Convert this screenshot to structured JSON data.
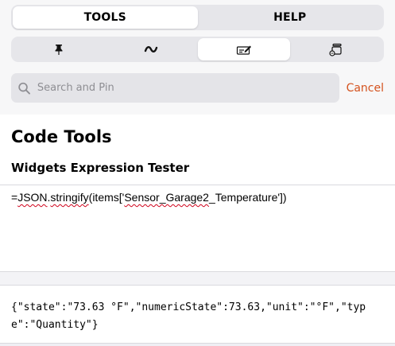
{
  "tabs": [
    {
      "label": "TOOLS",
      "active": true
    },
    {
      "label": "HELP",
      "active": false
    }
  ],
  "tool_icons": [
    {
      "icon": "pin-icon",
      "active": false
    },
    {
      "icon": "wave-icon",
      "active": false
    },
    {
      "icon": "code-edit-icon",
      "active": true
    },
    {
      "icon": "developer-sidebar-icon",
      "active": false
    }
  ],
  "search": {
    "placeholder": "Search and Pin",
    "cancel_label": "Cancel"
  },
  "main": {
    "title": "Code Tools",
    "section_title": "Widgets Expression Tester"
  },
  "editor": {
    "expr_prefix": "=",
    "expr_json": "JSON",
    "expr_mid1": ".",
    "expr_stringify": "stringify",
    "expr_mid2": "(items['",
    "expr_sensor": "Sensor_Garage2",
    "expr_suffix": "_Temperature'])"
  },
  "result": {
    "text": "{\"state\":\"73.63 °F\",\"numericState\":73.63,\"unit\":\"°F\",\"type\":\"Quantity\"}"
  },
  "colors": {
    "accent": "#d4521e",
    "spellcheck": "#d0021b"
  }
}
